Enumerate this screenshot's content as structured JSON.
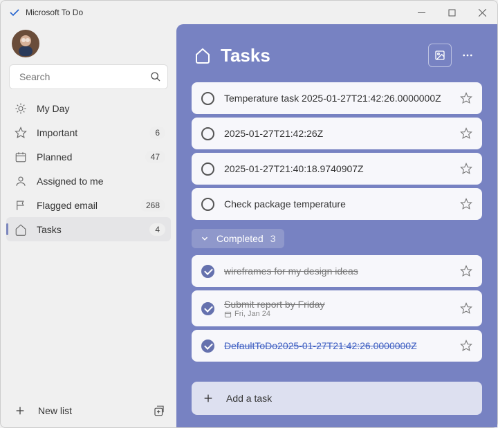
{
  "app": {
    "title": "Microsoft To Do"
  },
  "search": {
    "placeholder": "Search"
  },
  "sidebar": {
    "items": [
      {
        "label": "My Day",
        "count": ""
      },
      {
        "label": "Important",
        "count": "6"
      },
      {
        "label": "Planned",
        "count": "47"
      },
      {
        "label": "Assigned to me",
        "count": ""
      },
      {
        "label": "Flagged email",
        "count": "268"
      },
      {
        "label": "Tasks",
        "count": "4"
      }
    ],
    "newlist": "New list"
  },
  "header": {
    "title": "Tasks"
  },
  "tasks": [
    {
      "title": "Temperature task 2025-01-27T21:42:26.0000000Z"
    },
    {
      "title": "2025-01-27T21:42:26Z"
    },
    {
      "title": "2025-01-27T21:40:18.9740907Z"
    },
    {
      "title": "Check package temperature"
    }
  ],
  "completed": {
    "label": "Completed",
    "count": "3",
    "items": [
      {
        "title": "wireframes for my design ideas",
        "sub": ""
      },
      {
        "title": "Submit report by Friday",
        "sub": "Fri, Jan 24"
      },
      {
        "title": "DefaultToDo2025-01-27T21:42:26.0000000Z",
        "sub": "",
        "highlight": true
      }
    ]
  },
  "addTask": {
    "label": "Add a task"
  }
}
